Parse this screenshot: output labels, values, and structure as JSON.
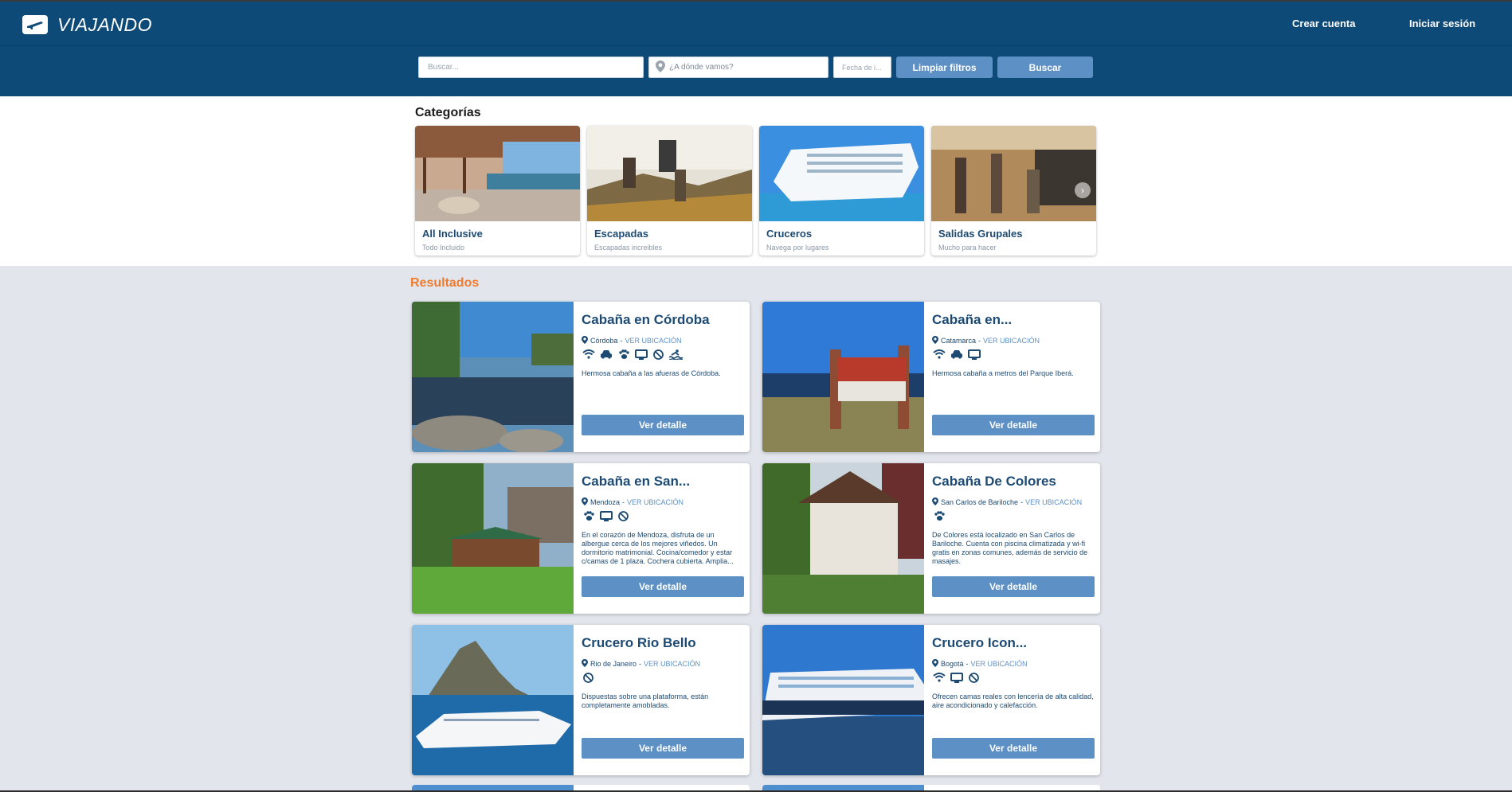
{
  "header": {
    "brand": "VIAJANDO",
    "brand_icon": "plane-ticket-icon",
    "nav": {
      "create_account": "Crear cuenta",
      "login": "Iniciar sesión"
    }
  },
  "search": {
    "query_placeholder": "Buscar...",
    "destination_placeholder": "¿A dónde vamos?",
    "date_placeholder": "Fecha de i...",
    "clear_label": "Limpiar filtros",
    "search_label": "Buscar"
  },
  "categories": {
    "title": "Categorías",
    "items": [
      {
        "title": "All Inclusive",
        "subtitle": "Todo Incluido"
      },
      {
        "title": "Escapadas",
        "subtitle": "Escapadas increibles"
      },
      {
        "title": "Cruceros",
        "subtitle": "Navega por lugares"
      },
      {
        "title": "Salidas Grupales",
        "subtitle": "Mucho para hacer"
      }
    ]
  },
  "results": {
    "title": "Resultados",
    "map_link": "VER UBICACIÓN",
    "detail_label": "Ver detalle",
    "items": [
      {
        "title": "Cabaña en Córdoba",
        "location": "Córdoba",
        "amenities": [
          "wifi-icon",
          "car-icon",
          "paw-icon",
          "tv-icon",
          "no-smoking-icon",
          "pool-icon"
        ],
        "description": "Hermosa cabaña a las afueras de Córdoba."
      },
      {
        "title": "Cabaña en...",
        "location": "Catamarca",
        "amenities": [
          "wifi-icon",
          "car-icon",
          "tv-icon"
        ],
        "description": "Hermosa cabaña a metros del Parque Iberá."
      },
      {
        "title": "Cabaña en San...",
        "location": "Mendoza",
        "amenities": [
          "paw-icon",
          "tv-icon",
          "no-smoking-icon"
        ],
        "description": "En el corazón de Mendoza, disfruta de un albergue cerca de los mejores viñedos. Un dormitorio matrimonial. Cocina/comedor y estar c/camas de 1 plaza. Cochera cubierta. Amplia..."
      },
      {
        "title": "Cabaña De Colores",
        "location": "San Carlos de Bariloche",
        "amenities": [
          "paw-icon"
        ],
        "description": "De Colores está localizado en San Carlos de Bariloche. Cuenta con piscina climatizada y wi-fi gratis en zonas comunes, además de servicio de masajes."
      },
      {
        "title": "Crucero Rio Bello",
        "location": "Rio de Janeiro",
        "amenities": [
          "no-smoking-icon"
        ],
        "description": "Dispuestas sobre una plataforma, están completamente amobladas."
      },
      {
        "title": "Crucero Icon...",
        "location": "Bogotá",
        "amenities": [
          "wifi-icon",
          "tv-icon",
          "no-smoking-icon"
        ],
        "description": "Ofrecen camas reales con lencería de alta calidad, aire acondicionado y calefacción."
      }
    ]
  },
  "colors": {
    "header": "#0e4a78",
    "accent": "#5d90c4",
    "results_title": "#f07b2c",
    "text": "#1c4a73"
  }
}
